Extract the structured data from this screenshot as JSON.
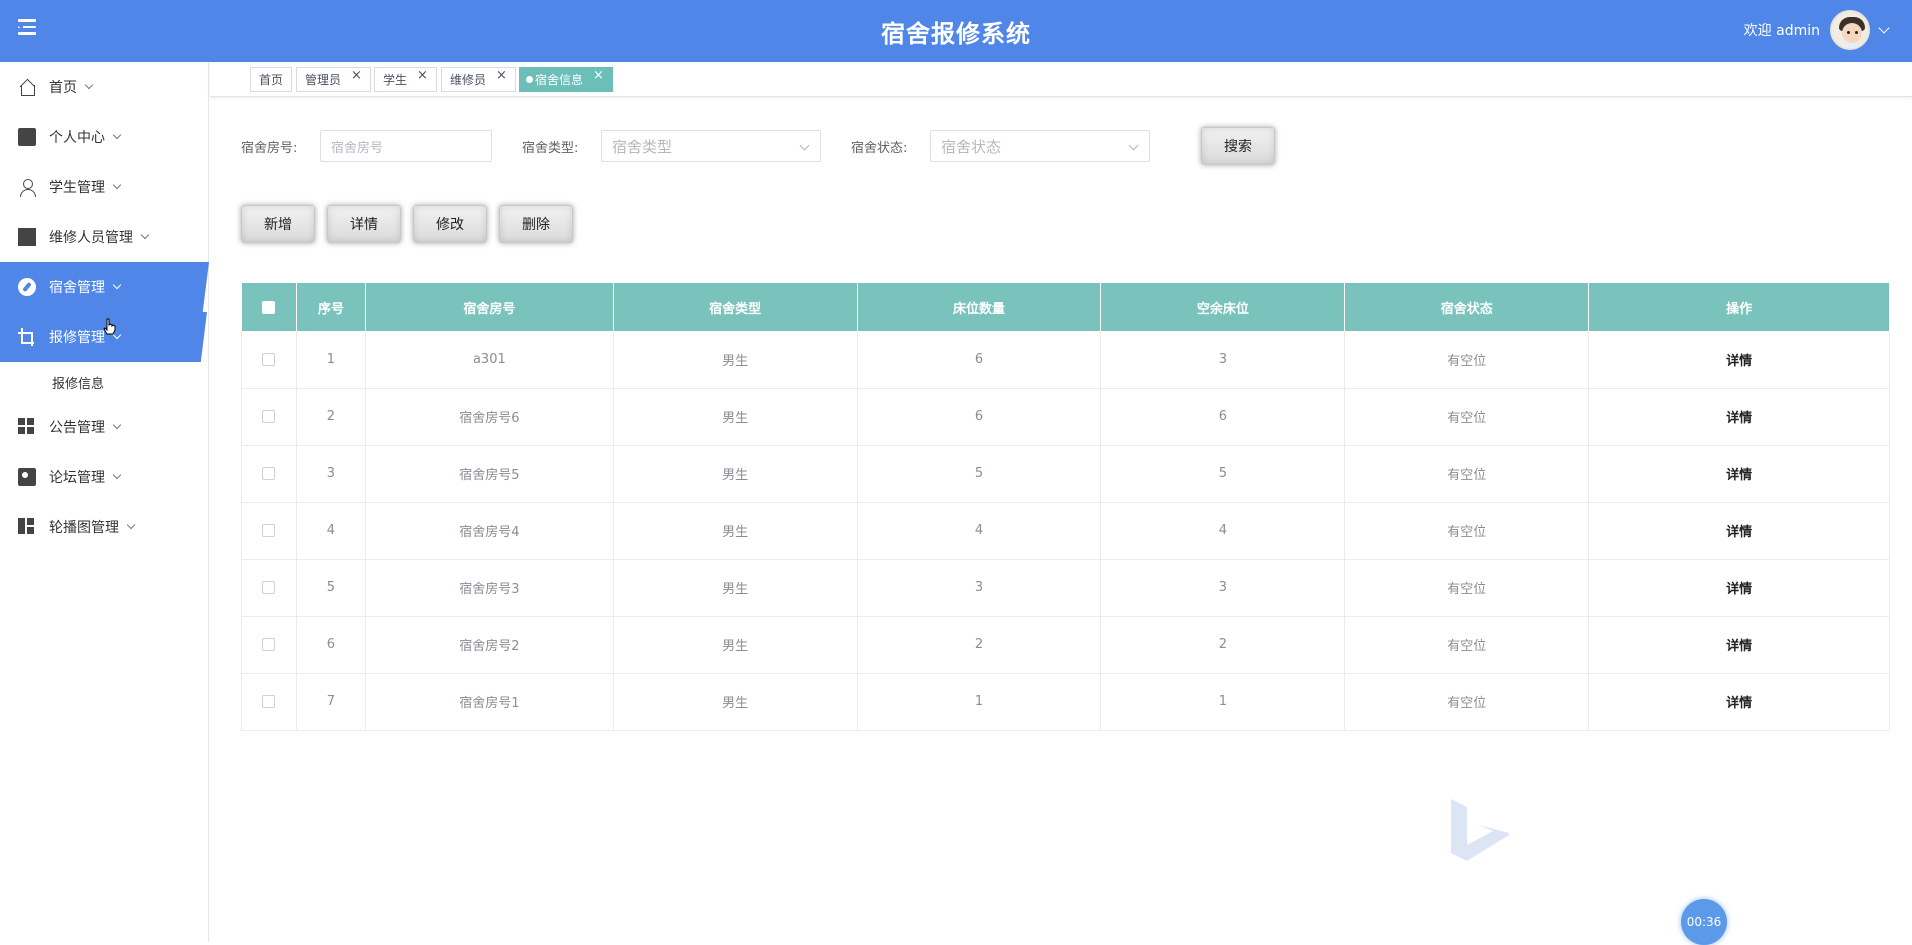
{
  "header": {
    "title": "宿舍报修系统",
    "welcome": "欢迎 admin",
    "accent_color": "#4f86e8"
  },
  "sidebar": {
    "items": [
      {
        "label": "首页",
        "icon": "home-icon"
      },
      {
        "label": "个人中心",
        "icon": "wallet-icon"
      },
      {
        "label": "学生管理",
        "icon": "person-icon"
      },
      {
        "label": "维修人员管理",
        "icon": "ticket-icon"
      },
      {
        "label": "宿舍管理",
        "icon": "compass-icon",
        "active": true
      },
      {
        "label": "报修管理",
        "icon": "crop-icon",
        "active": true,
        "expanded": true
      },
      {
        "label": "公告管理",
        "icon": "grid-icon"
      },
      {
        "label": "论坛管理",
        "icon": "book-icon"
      },
      {
        "label": "轮播图管理",
        "icon": "dashboard-icon"
      }
    ],
    "sub_items": [
      "报修信息"
    ]
  },
  "tabs": [
    {
      "label": "首页"
    },
    {
      "label": "管理员"
    },
    {
      "label": "学生"
    },
    {
      "label": "维修员"
    },
    {
      "label": "宿舍信息",
      "active": true
    }
  ],
  "search": {
    "room_label": "宿舍房号:",
    "room_placeholder": "宿舍房号",
    "type_label": "宿舍类型:",
    "type_placeholder": "宿舍类型",
    "status_label": "宿舍状态:",
    "status_placeholder": "宿舍状态",
    "search_button": "搜索"
  },
  "actions": {
    "add": "新增",
    "detail": "详情",
    "edit": "修改",
    "delete": "删除"
  },
  "table": {
    "headers": [
      "序号",
      "宿舍房号",
      "宿舍类型",
      "床位数量",
      "空余床位",
      "宿舍状态",
      "操作"
    ],
    "rows": [
      {
        "no": "1",
        "room": "a301",
        "type": "男生",
        "beds": "6",
        "free": "3",
        "status": "有空位",
        "op": "详情"
      },
      {
        "no": "2",
        "room": "宿舍房号6",
        "type": "男生",
        "beds": "6",
        "free": "6",
        "status": "有空位",
        "op": "详情"
      },
      {
        "no": "3",
        "room": "宿舍房号5",
        "type": "男生",
        "beds": "5",
        "free": "5",
        "status": "有空位",
        "op": "详情"
      },
      {
        "no": "4",
        "room": "宿舍房号4",
        "type": "男生",
        "beds": "4",
        "free": "4",
        "status": "有空位",
        "op": "详情"
      },
      {
        "no": "5",
        "room": "宿舍房号3",
        "type": "男生",
        "beds": "3",
        "free": "3",
        "status": "有空位",
        "op": "详情"
      },
      {
        "no": "6",
        "room": "宿舍房号2",
        "type": "男生",
        "beds": "2",
        "free": "2",
        "status": "有空位",
        "op": "详情"
      },
      {
        "no": "7",
        "room": "宿舍房号1",
        "type": "男生",
        "beds": "1",
        "free": "1",
        "status": "有空位",
        "op": "详情"
      }
    ],
    "header_color": "#79c3bc"
  },
  "timer": "00:36"
}
